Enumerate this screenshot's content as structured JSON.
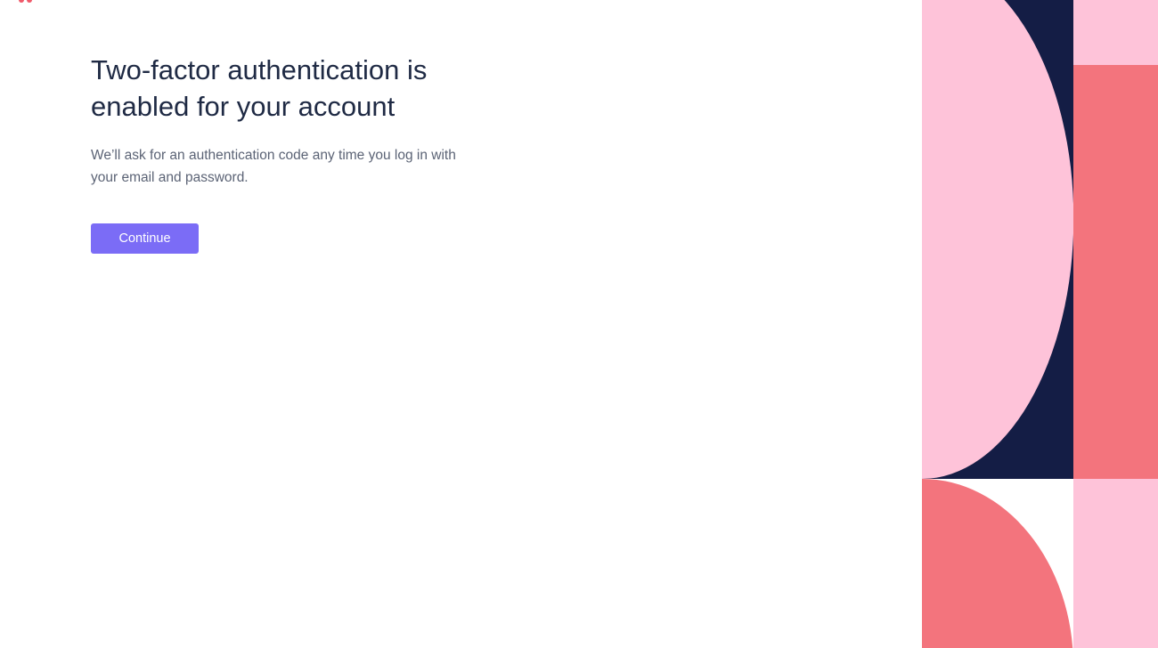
{
  "main": {
    "title": "Two-factor authentication is enabled for your account",
    "subtitle": "We’ll ask for an authentication code any time you log in with your email and password.",
    "continue_label": "Continue"
  },
  "colors": {
    "accent": "#7b6cf6",
    "heading": "#1f2a44",
    "body_text": "#5b6375",
    "decor_navy": "#141d45",
    "decor_pink": "#fec3d9",
    "decor_coral": "#f3747d",
    "logo": "#f05a6a"
  },
  "icons": {
    "logo": "brand-logo-icon",
    "decoration": "geometric-pattern"
  }
}
